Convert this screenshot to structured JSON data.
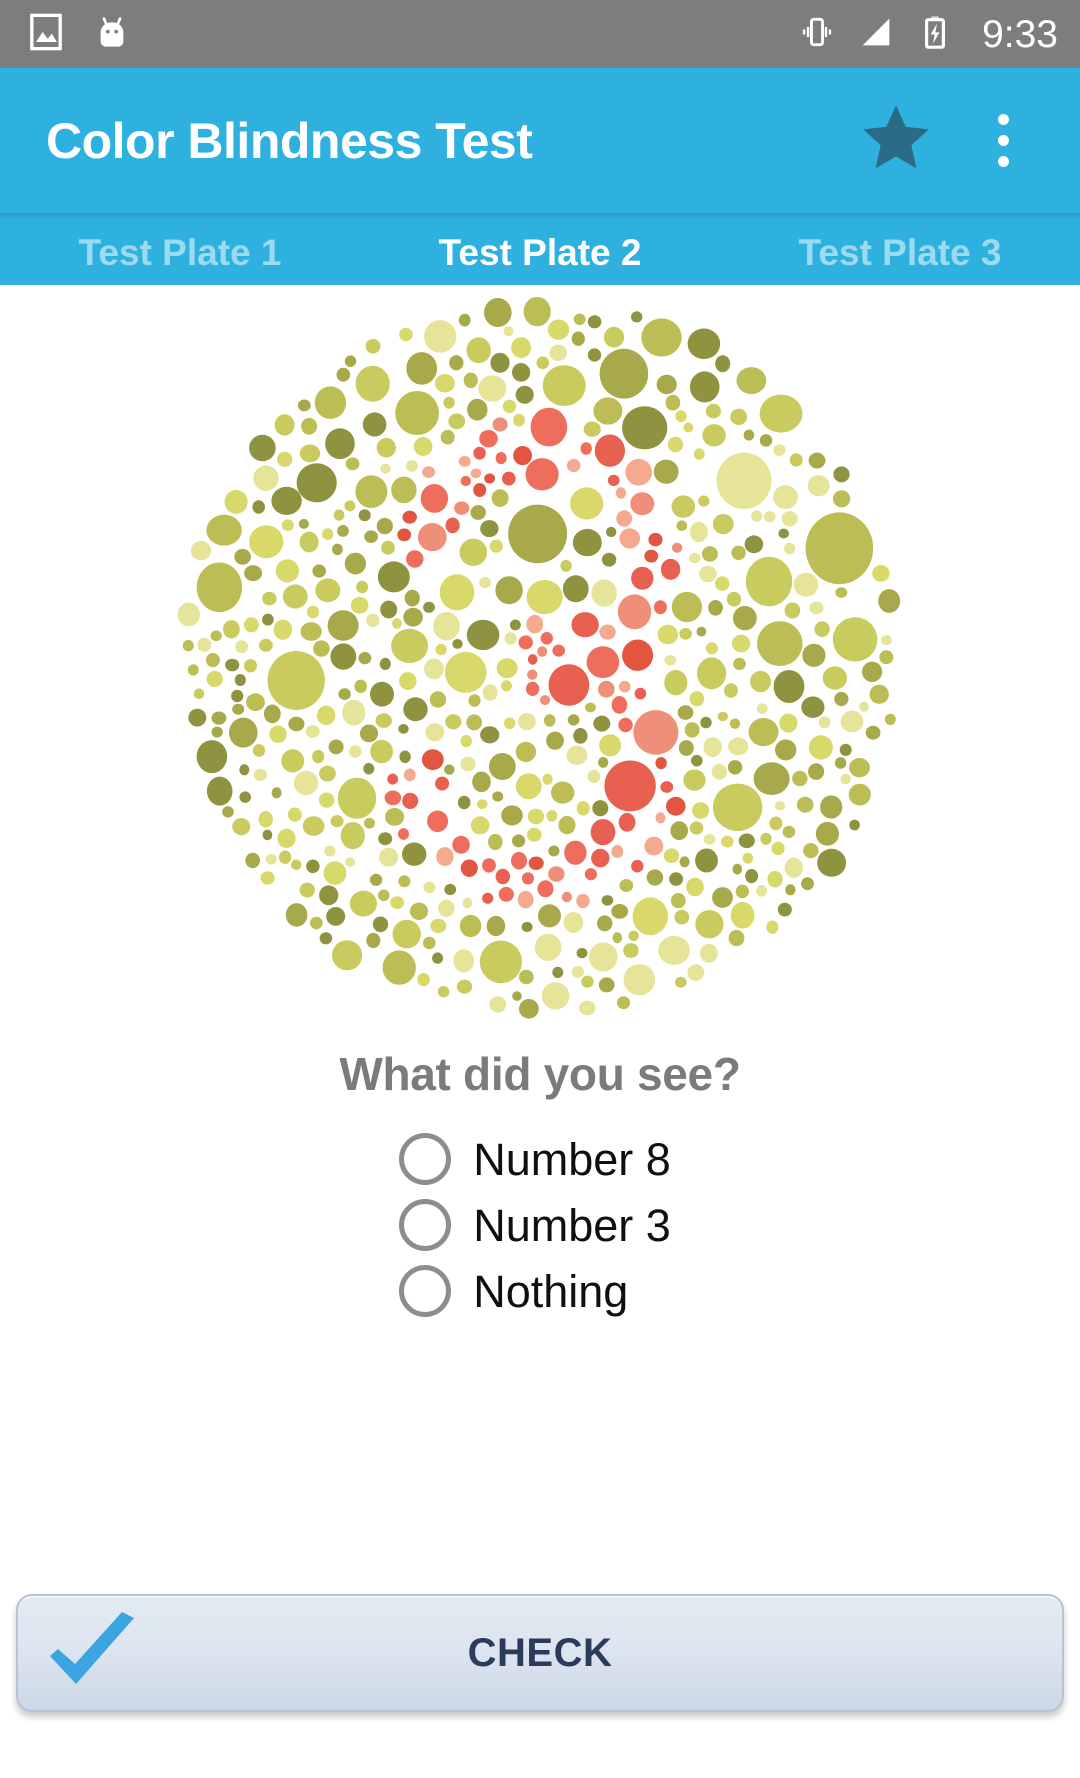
{
  "status_bar": {
    "icons_left": [
      "image-icon",
      "android-mascot-icon"
    ],
    "icons_right": [
      "vibrate-icon",
      "signal-icon",
      "battery-charging-icon"
    ],
    "clock": "9:33",
    "background": "#7d7d7d"
  },
  "app_bar": {
    "title": "Color Blindness Test",
    "background": "#2fb1e0",
    "star_icon": "star-icon",
    "star_color": "#2c6b86",
    "overflow_icon": "overflow-menu-icon"
  },
  "tabs": {
    "active_index": 1,
    "items": [
      {
        "label": "Test Plate 1"
      },
      {
        "label": "Test Plate 2"
      },
      {
        "label": "Test Plate 3"
      }
    ]
  },
  "plate": {
    "name": "ishihara-plate-image",
    "hidden_number": "3",
    "background_colors": [
      "#d9d86a",
      "#c9cb5f",
      "#a8a94a",
      "#8f9340",
      "#e5e498",
      "#bcbe55"
    ],
    "figure_colors": [
      "#e8604f",
      "#f08f79",
      "#ef6d5c",
      "#f5a98e",
      "#e2553f"
    ]
  },
  "question": {
    "text": "What did you see?",
    "color": "#7b7b7b"
  },
  "options": [
    {
      "label": "Number 8",
      "selected": false
    },
    {
      "label": "Number 3",
      "selected": false
    },
    {
      "label": "Nothing",
      "selected": false
    }
  ],
  "check_button": {
    "label": "CHECK",
    "icon": "checkmark-icon",
    "icon_color": "#3aa5e0",
    "text_color": "#2b3b5c"
  }
}
